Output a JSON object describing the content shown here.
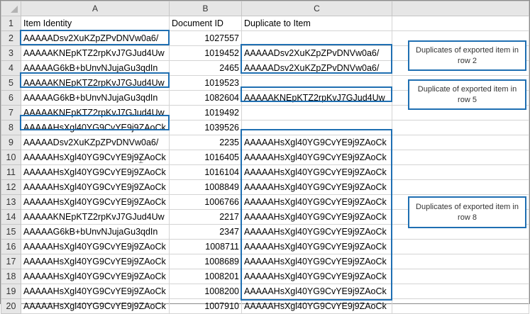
{
  "columns": [
    "A",
    "B",
    "C"
  ],
  "headers": {
    "item_identity": "Item Identity",
    "document_id": "Document ID",
    "duplicate_to_item": "Duplicate to Item"
  },
  "rows": [
    {
      "n": "1",
      "a": "Item Identity",
      "b": "Document ID",
      "c": "Duplicate to Item"
    },
    {
      "n": "2",
      "a": "AAAAADsv2XuKZpZPvDNVw0a6/",
      "b": "1027557",
      "c": ""
    },
    {
      "n": "3",
      "a": "AAAAAKNEpKTZ2rpKvJ7GJud4Uw",
      "b": "1019452",
      "c": "AAAAADsv2XuKZpZPvDNVw0a6/"
    },
    {
      "n": "4",
      "a": "AAAAAG6kB+bUnvNJujaGu3qdIn",
      "b": "2465",
      "c": "AAAAADsv2XuKZpZPvDNVw0a6/"
    },
    {
      "n": "5",
      "a": "AAAAAKNEpKTZ2rpKvJ7GJud4Uw",
      "b": "1019523",
      "c": ""
    },
    {
      "n": "6",
      "a": "AAAAAG6kB+bUnvNJujaGu3qdIn",
      "b": "1082604",
      "c": "AAAAAKNEpKTZ2rpKvJ7GJud4Uw"
    },
    {
      "n": "7",
      "a": "AAAAAKNEpKTZ2rpKvJ7GJud4Uw",
      "b": "1019492",
      "c": ""
    },
    {
      "n": "8",
      "a": "AAAAAHsXgl40YG9CvYE9j9ZAoCk",
      "b": "1039526",
      "c": ""
    },
    {
      "n": "9",
      "a": "AAAAADsv2XuKZpZPvDNVw0a6/",
      "b": "2235",
      "c": "AAAAAHsXgl40YG9CvYE9j9ZAoCk"
    },
    {
      "n": "10",
      "a": "AAAAAHsXgl40YG9CvYE9j9ZAoCk",
      "b": "1016405",
      "c": "AAAAAHsXgl40YG9CvYE9j9ZAoCk"
    },
    {
      "n": "11",
      "a": "AAAAAHsXgl40YG9CvYE9j9ZAoCk",
      "b": "1016104",
      "c": "AAAAAHsXgl40YG9CvYE9j9ZAoCk"
    },
    {
      "n": "12",
      "a": "AAAAAHsXgl40YG9CvYE9j9ZAoCk",
      "b": "1008849",
      "c": "AAAAAHsXgl40YG9CvYE9j9ZAoCk"
    },
    {
      "n": "13",
      "a": "AAAAAHsXgl40YG9CvYE9j9ZAoCk",
      "b": "1006766",
      "c": "AAAAAHsXgl40YG9CvYE9j9ZAoCk"
    },
    {
      "n": "14",
      "a": "AAAAAKNEpKTZ2rpKvJ7GJud4Uw",
      "b": "2217",
      "c": "AAAAAHsXgl40YG9CvYE9j9ZAoCk"
    },
    {
      "n": "15",
      "a": "AAAAAG6kB+bUnvNJujaGu3qdIn",
      "b": "2347",
      "c": "AAAAAHsXgl40YG9CvYE9j9ZAoCk"
    },
    {
      "n": "16",
      "a": "AAAAAHsXgl40YG9CvYE9j9ZAoCk",
      "b": "1008711",
      "c": "AAAAAHsXgl40YG9CvYE9j9ZAoCk"
    },
    {
      "n": "17",
      "a": "AAAAAHsXgl40YG9CvYE9j9ZAoCk",
      "b": "1008689",
      "c": "AAAAAHsXgl40YG9CvYE9j9ZAoCk"
    },
    {
      "n": "18",
      "a": "AAAAAHsXgl40YG9CvYE9j9ZAoCk",
      "b": "1008201",
      "c": "AAAAAHsXgl40YG9CvYE9j9ZAoCk"
    },
    {
      "n": "19",
      "a": "AAAAAHsXgl40YG9CvYE9j9ZAoCk",
      "b": "1008200",
      "c": "AAAAAHsXgl40YG9CvYE9j9ZAoCk"
    },
    {
      "n": "20",
      "a": "AAAAAHsXgl40YG9CvYE9j9ZAoCk",
      "b": "1007910",
      "c": "AAAAAHsXgl40YG9CvYE9j9ZAoCk"
    }
  ],
  "callouts": {
    "row2": "Duplicates of exported item in row 2",
    "row5": "Duplicate of exported item in row 5",
    "row8": "Duplicates of exported item in row 8"
  },
  "colors": {
    "highlight": "#1f6fb2",
    "header_bg": "#e6e6e6",
    "gridline": "#d4d4d4"
  },
  "icons": {
    "select_all": "select-all-triangle-icon",
    "cursor": "text-cursor-icon"
  }
}
